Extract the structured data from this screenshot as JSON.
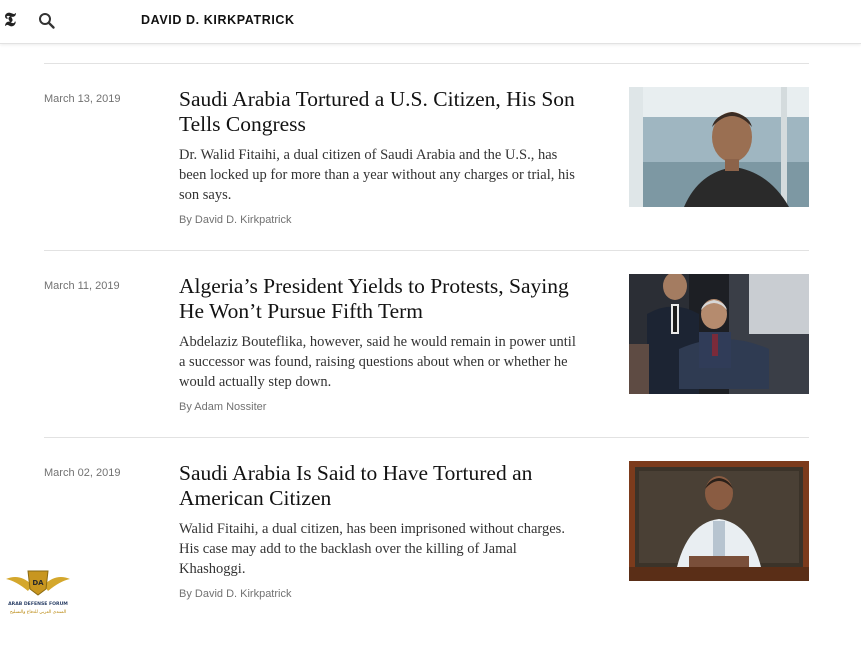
{
  "header": {
    "logo_glyph": "𝕿",
    "logo_icon": "nyt-logo-icon",
    "search_icon": "search-icon",
    "title": "DAVID D. KIRKPATRICK"
  },
  "articles": [
    {
      "date": "March 13, 2019",
      "headline": "Saudi Arabia Tortured a U.S. Citizen, His Son Tells Congress",
      "summary": "Dr. Walid Fitaihi, a dual citizen of Saudi Arabia and the U.S., has been locked up for more than a year without any charges or trial, his son says.",
      "byline": "By David D. Kirkpatrick"
    },
    {
      "date": "March 11, 2019",
      "headline": "Algeria’s President Yields to Protests, Saying He Won’t Pursue Fifth Term",
      "summary": "Abdelaziz Bouteflika, however, said he would remain in power until a successor was found, raising questions about when or whether he would actually step down.",
      "byline": "By Adam Nossiter"
    },
    {
      "date": "March 02, 2019",
      "headline": "Saudi Arabia Is Said to Have Tortured an American Citizen",
      "summary": "Walid Fitaihi, a dual citizen, has been imprisoned without charges. His case may add to the backlash over the killing of Jamal Khashoggi.",
      "byline": "By David D. Kirkpatrick"
    }
  ],
  "watermark": {
    "line1": "ARAB DEFENSE FORUM",
    "line2": "المنتدى العربي للدفاع والتسليح",
    "monogram": "DA"
  }
}
